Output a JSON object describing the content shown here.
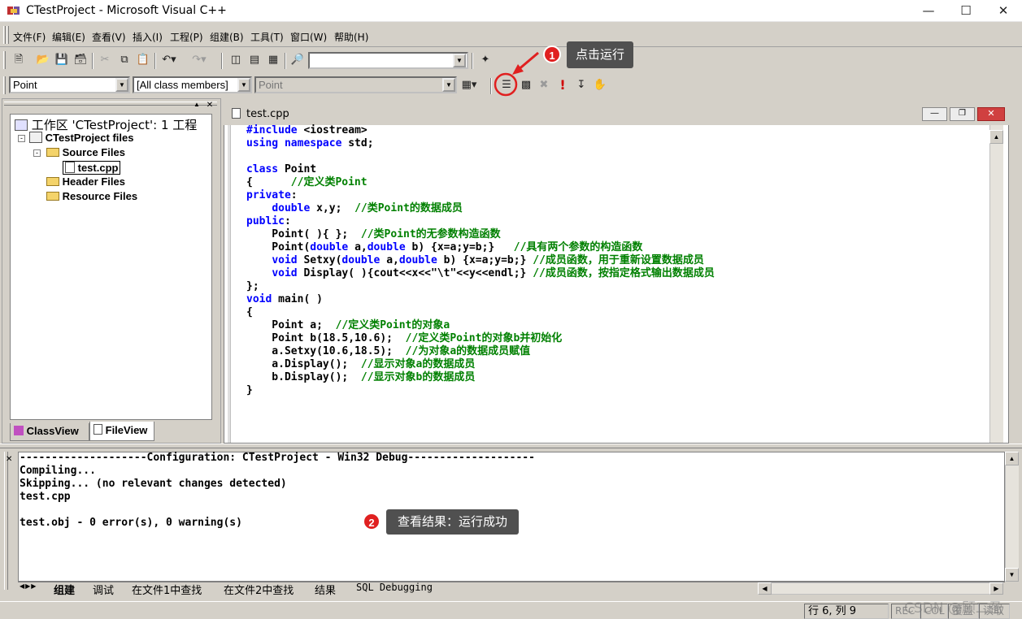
{
  "window": {
    "title": "CTestProject - Microsoft Visual C++"
  },
  "menu": [
    "文件(F)",
    "编辑(E)",
    "查看(V)",
    "插入(I)",
    "工程(P)",
    "组建(B)",
    "工具(T)",
    "窗口(W)",
    "帮助(H)"
  ],
  "toolbar": {
    "class_combo": "Point",
    "members_combo": "[All class members]",
    "function_combo": "Point"
  },
  "annotations": {
    "step1_num": "1",
    "step1_text": "点击运行",
    "step2_num": "2",
    "step2_text": "查看结果：运行成功"
  },
  "workspace": {
    "root": "工作区 'CTestProject': 1 工程",
    "project": "CTestProject files",
    "source_files": "Source Files",
    "file": "test.cpp",
    "header_files": "Header Files",
    "resource_files": "Resource Files",
    "tab_classview": "ClassView",
    "tab_fileview": "FileView"
  },
  "editor": {
    "title": "test.cpp"
  },
  "output": {
    "lines": [
      "--------------------Configuration: CTestProject - Win32 Debug--------------------",
      "Compiling...",
      "Skipping... (no relevant changes detected)",
      "test.cpp",
      "",
      "test.obj - 0 error(s), 0 warning(s)"
    ],
    "tabs": [
      "组建",
      "调试",
      "在文件1中查找",
      "在文件2中查找",
      "结果",
      "SQL Debugging"
    ]
  },
  "status": {
    "position": "行 6, 列 9",
    "rec": "REC",
    "col": "COL",
    "ovr": "覆盖",
    "read": "读取",
    "watermark": "CSDN @顾二盈"
  },
  "colors": {
    "keyword": "#0000ff",
    "comment": "#008000",
    "highlight_circle": "#e02020",
    "callout_bg": "#505050"
  }
}
